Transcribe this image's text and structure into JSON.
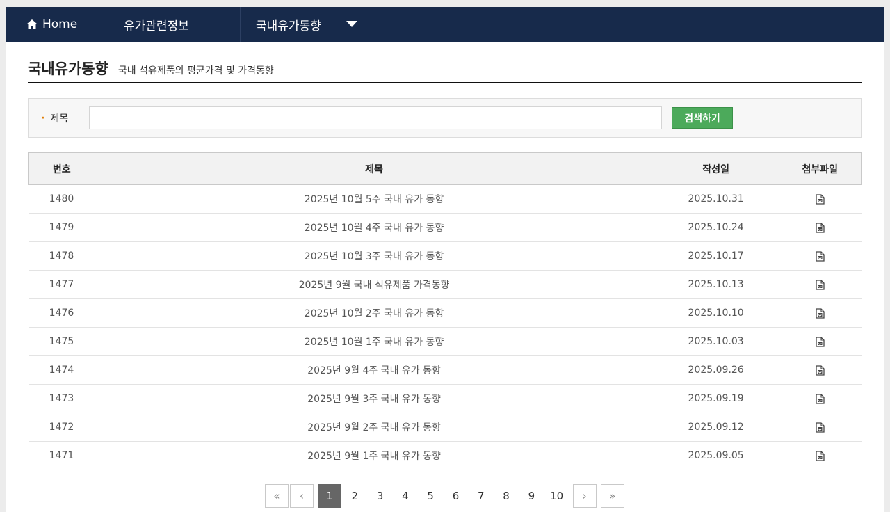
{
  "nav": {
    "home_label": "Home",
    "info_label": "유가관련정보",
    "domestic_label": "국내유가동향"
  },
  "page": {
    "title": "국내유가동향",
    "subtitle": "국내 석유제품의 평균가격 및 가격동향"
  },
  "search": {
    "label": "제목",
    "value": "",
    "placeholder": "",
    "button_label": "검색하기"
  },
  "table": {
    "headers": [
      "번호",
      "제목",
      "작성일",
      "첨부파일"
    ],
    "rows": [
      {
        "num": "1480",
        "title": "2025년 10월 5주 국내 유가 동향",
        "date": "2025.10.31",
        "file": "file-icon"
      },
      {
        "num": "1479",
        "title": "2025년 10월 4주 국내 유가 동향",
        "date": "2025.10.24",
        "file": "file-icon"
      },
      {
        "num": "1478",
        "title": "2025년 10월 3주 국내 유가 동향",
        "date": "2025.10.17",
        "file": "file-icon"
      },
      {
        "num": "1477",
        "title": "2025년 9월 국내 석유제품 가격동향",
        "date": "2025.10.13",
        "file": "file-icon"
      },
      {
        "num": "1476",
        "title": "2025년 10월 2주 국내 유가 동향",
        "date": "2025.10.10",
        "file": "file-icon"
      },
      {
        "num": "1475",
        "title": "2025년 10월 1주 국내 유가 동향",
        "date": "2025.10.03",
        "file": "file-icon"
      },
      {
        "num": "1474",
        "title": "2025년 9월 4주 국내 유가 동향",
        "date": "2025.09.26",
        "file": "file-icon"
      },
      {
        "num": "1473",
        "title": "2025년 9월 3주 국내 유가 동향",
        "date": "2025.09.19",
        "file": "file-icon"
      },
      {
        "num": "1472",
        "title": "2025년 9월 2주 국내 유가 동향",
        "date": "2025.09.12",
        "file": "file-icon"
      },
      {
        "num": "1471",
        "title": "2025년 9월 1주 국내 유가 동향",
        "date": "2025.09.05",
        "file": "file-icon"
      }
    ]
  },
  "pagination": {
    "first": "«",
    "prev": "‹",
    "next": "›",
    "last": "»",
    "pages": [
      "1",
      "2",
      "3",
      "4",
      "5",
      "6",
      "7",
      "8",
      "9",
      "10"
    ],
    "current": "1"
  },
  "colors": {
    "nav_bg": "#172a4b",
    "search_button": "#4caa5b",
    "active_page": "#666666",
    "bullet": "#e07b00"
  }
}
